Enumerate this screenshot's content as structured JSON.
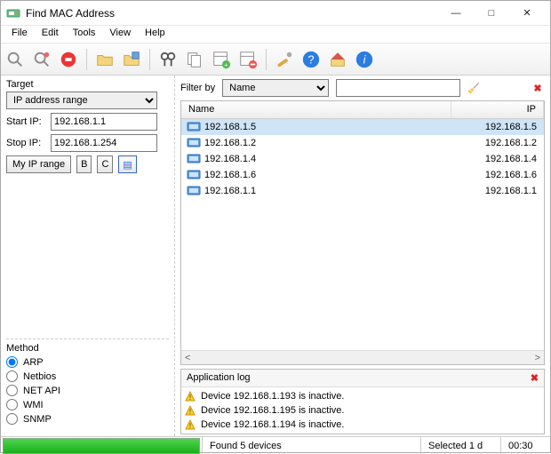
{
  "window": {
    "title": "Find MAC Address"
  },
  "menu": [
    "File",
    "Edit",
    "Tools",
    "View",
    "Help"
  ],
  "target": {
    "label": "Target",
    "mode_options": [
      "IP address range"
    ],
    "mode_selected": "IP address range",
    "start_label": "Start IP:",
    "start_value": "192.168.1.1",
    "stop_label": "Stop IP:",
    "stop_value": "192.168.1.254",
    "btn_myrange": "My IP range",
    "btn_b": "B",
    "btn_c": "C"
  },
  "method": {
    "label": "Method",
    "options": [
      "ARP",
      "Netbios",
      "NET API",
      "WMI",
      "SNMP"
    ],
    "selected": "ARP"
  },
  "filter": {
    "label": "Filter by",
    "field_selected": "Name",
    "value": ""
  },
  "columns": {
    "name": "Name",
    "ip": "IP"
  },
  "rows": [
    {
      "name": "192.168.1.5",
      "ip": "192.168.1.5",
      "selected": true
    },
    {
      "name": "192.168.1.2",
      "ip": "192.168.1.2",
      "selected": false
    },
    {
      "name": "192.168.1.4",
      "ip": "192.168.1.4",
      "selected": false
    },
    {
      "name": "192.168.1.6",
      "ip": "192.168.1.6",
      "selected": false
    },
    {
      "name": "192.168.1.1",
      "ip": "192.168.1.1",
      "selected": false
    }
  ],
  "log": {
    "label": "Application log",
    "lines": [
      "Device 192.168.1.193 is inactive.",
      "Device 192.168.1.195 is inactive.",
      "Device 192.168.1.194 is inactive."
    ]
  },
  "status": {
    "found": "Found 5 devices",
    "selected": "Selected 1 d",
    "time": "00:30"
  }
}
